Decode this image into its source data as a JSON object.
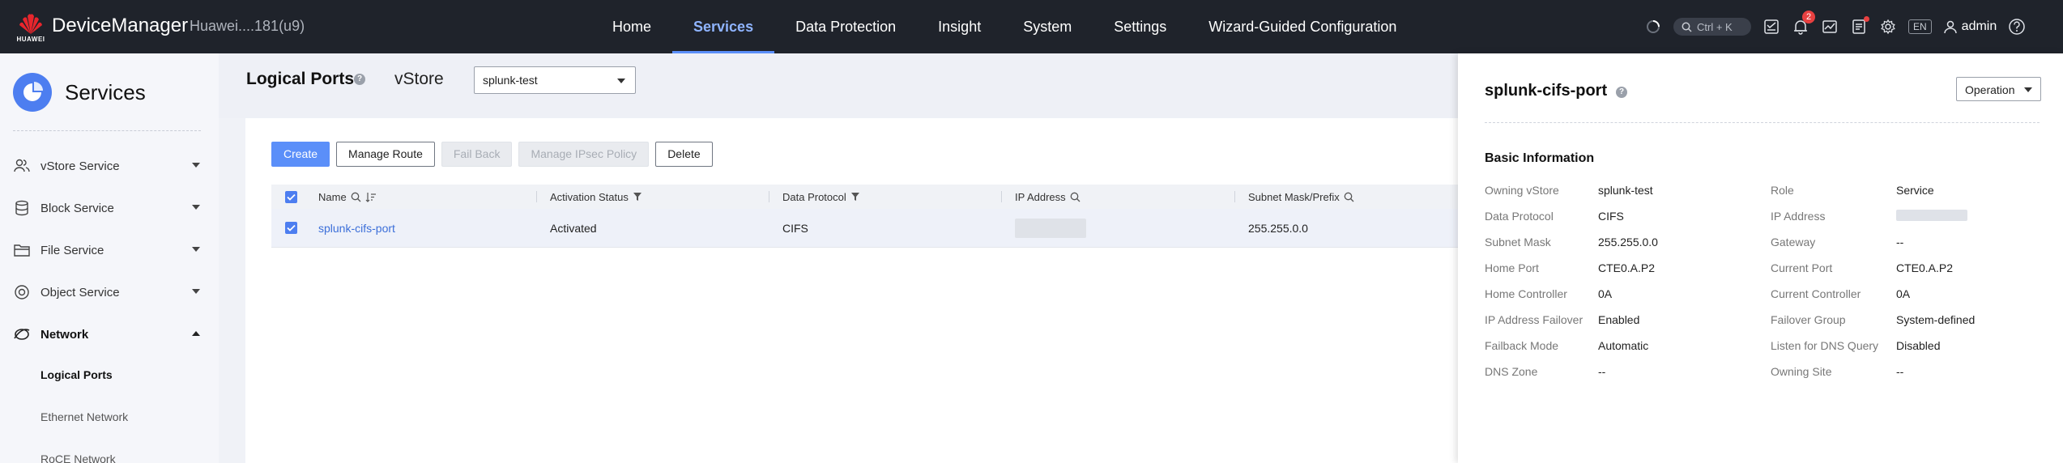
{
  "header": {
    "app_name": "DeviceManager",
    "logo_text": "HUAWEI",
    "device_name": "Huawei....181(u9)",
    "nav": [
      {
        "label": "Home"
      },
      {
        "label": "Services",
        "active": true
      },
      {
        "label": "Data Protection"
      },
      {
        "label": "Insight"
      },
      {
        "label": "System"
      },
      {
        "label": "Settings"
      },
      {
        "label": "Wizard-Guided Configuration"
      }
    ],
    "search_shortcut": "Ctrl + K",
    "alarm_count": "2",
    "lang": "EN",
    "user": "admin",
    "icons": [
      "spinner-icon",
      "search-icon",
      "task-icon",
      "bell-icon",
      "monitor-icon",
      "report-icon",
      "gear-icon",
      "user-icon",
      "help-icon"
    ],
    "accent_color": "#5b8ff9",
    "badge_color": "#e84040"
  },
  "sidebar": {
    "title": "Services",
    "items": [
      {
        "label": "vStore Service",
        "icon": "users-icon"
      },
      {
        "label": "Block Service",
        "icon": "database-icon"
      },
      {
        "label": "File Service",
        "icon": "folder-icon"
      },
      {
        "label": "Object Service",
        "icon": "object-icon"
      },
      {
        "label": "Network",
        "icon": "network-icon",
        "expanded": true
      }
    ],
    "subitems": [
      {
        "label": "Logical Ports",
        "active": true
      },
      {
        "label": "Ethernet Network"
      },
      {
        "label": "RoCE Network"
      }
    ]
  },
  "main": {
    "title": "Logical Ports",
    "vstore_label": "vStore",
    "vstore_selected": "splunk-test",
    "toolbar": {
      "create": "Create",
      "manage_route": "Manage Route",
      "fail_back": "Fail Back",
      "manage_ipsec": "Manage IPsec Policy",
      "delete": "Delete"
    },
    "table": {
      "columns": [
        "Name",
        "Activation Status",
        "Data Protocol",
        "IP Address",
        "Subnet Mask/Prefix"
      ],
      "rows": [
        {
          "name": "splunk-cifs-port",
          "status": "Activated",
          "protocol": "CIFS",
          "ip": "",
          "mask": "255.255.0.0"
        }
      ]
    }
  },
  "drawer": {
    "title": "splunk-cifs-port",
    "operation": "Operation",
    "section": "Basic Information",
    "fields": [
      {
        "label": "Owning vStore",
        "value": "splunk-test"
      },
      {
        "label": "Role",
        "value": "Service"
      },
      {
        "label": "Data Protocol",
        "value": "CIFS"
      },
      {
        "label": "IP Address",
        "value": ""
      },
      {
        "label": "Subnet Mask",
        "value": "255.255.0.0"
      },
      {
        "label": "Gateway",
        "value": "--"
      },
      {
        "label": "Home Port",
        "value": "CTE0.A.P2"
      },
      {
        "label": "Current Port",
        "value": "CTE0.A.P2"
      },
      {
        "label": "Home Controller",
        "value": "0A"
      },
      {
        "label": "Current Controller",
        "value": "0A"
      },
      {
        "label": "IP Address Failover",
        "value": "Enabled"
      },
      {
        "label": "Failover Group",
        "value": "System-defined"
      },
      {
        "label": "Failback Mode",
        "value": "Automatic"
      },
      {
        "label": "Listen for DNS Query",
        "value": "Disabled"
      },
      {
        "label": "DNS Zone",
        "value": "--"
      },
      {
        "label": "Owning Site",
        "value": "--"
      }
    ]
  }
}
